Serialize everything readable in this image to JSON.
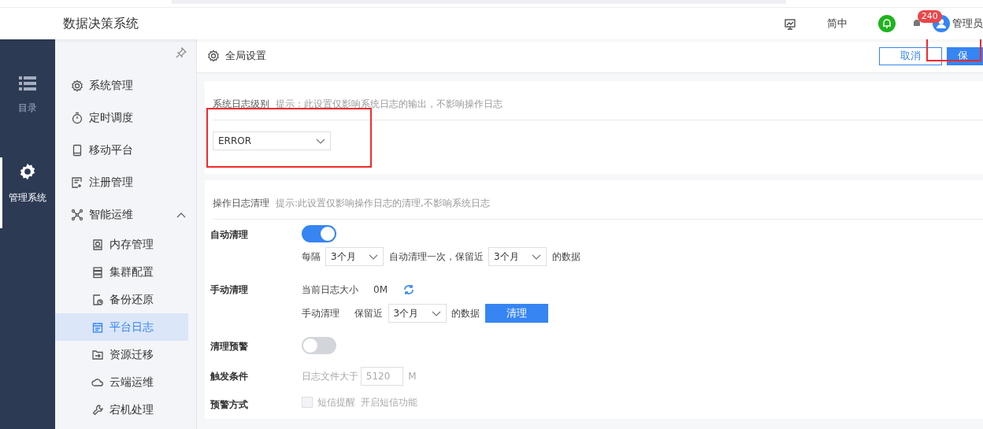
{
  "header": {
    "title": "数据决策系统",
    "language": "简中",
    "notification_count": "240",
    "user": "管理员"
  },
  "rail": [
    {
      "label": "目录",
      "selected": false
    },
    {
      "label": "管理系统",
      "selected": true
    }
  ],
  "sidebar": {
    "items": [
      {
        "label": "系统管理",
        "selected": false
      },
      {
        "label": "定时调度",
        "selected": false
      },
      {
        "label": "移动平台",
        "selected": false
      },
      {
        "label": "注册管理",
        "selected": false
      },
      {
        "label": "智能运维",
        "selected": false,
        "expanded": true,
        "children": [
          {
            "label": "内存管理",
            "selected": false
          },
          {
            "label": "集群配置",
            "selected": false
          },
          {
            "label": "备份还原",
            "selected": false
          },
          {
            "label": "平台日志",
            "selected": true
          },
          {
            "label": "资源迁移",
            "selected": false
          },
          {
            "label": "云端运维",
            "selected": false
          },
          {
            "label": "宕机处理",
            "selected": false
          }
        ]
      }
    ]
  },
  "toolbar": {
    "title": "全局设置",
    "cancel": "取消",
    "save": "保",
    "highlighted": true
  },
  "system_log": {
    "title": "系统日志级别",
    "hint": "提示：此设置仅影响系统日志的输出，不影响操作日志",
    "level": "ERROR",
    "highlighted": true
  },
  "operation_log": {
    "title": "操作日志清理",
    "hint": "提示:此设置仅影响操作日志的清理,不影响系统日志",
    "auto_clean": {
      "label": "自动清理",
      "on": true,
      "every": "每隔",
      "interval": "3个月",
      "middle": "自动清理一次，保留近",
      "keep": "3个月",
      "suffix": "的数据"
    },
    "manual_clean": {
      "label": "手动清理",
      "size_label": "当前日志大小",
      "size": "0M",
      "action_label": "手动清理",
      "keep_label": "保留近",
      "keep": "3个月",
      "suffix": "的数据",
      "button": "清理"
    },
    "warning": {
      "label": "清理预警",
      "on": false
    },
    "trigger": {
      "label": "触发条件",
      "prefix": "日志文件大于",
      "value": "5120",
      "unit": "M"
    },
    "method": {
      "label": "预警方式",
      "sms_checked": false,
      "sms": "短信提醒",
      "link": "开启短信功能"
    }
  }
}
